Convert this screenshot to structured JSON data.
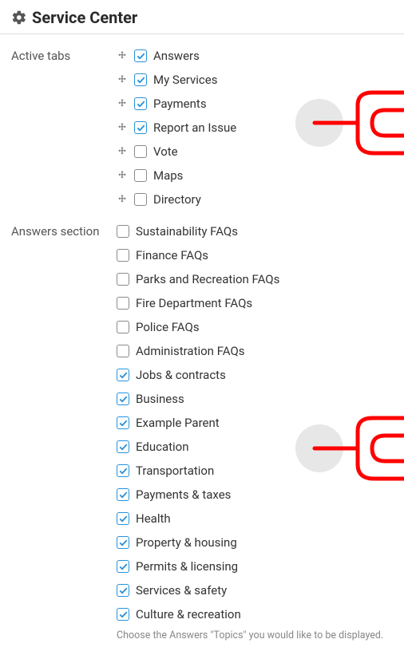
{
  "header": {
    "title": "Service Center"
  },
  "sections": {
    "active_tabs": {
      "label": "Active tabs",
      "items": [
        {
          "label": "Answers",
          "checked": true,
          "draggable": true
        },
        {
          "label": "My Services",
          "checked": true,
          "draggable": true
        },
        {
          "label": "Payments",
          "checked": true,
          "draggable": true
        },
        {
          "label": "Report an Issue",
          "checked": true,
          "draggable": true
        },
        {
          "label": "Vote",
          "checked": false,
          "draggable": true
        },
        {
          "label": "Maps",
          "checked": false,
          "draggable": true
        },
        {
          "label": "Directory",
          "checked": false,
          "draggable": true
        }
      ]
    },
    "answers_section": {
      "label": "Answers section",
      "helper": "Choose the Answers \"Topics\" you would like to be displayed.",
      "items": [
        {
          "label": "Sustainability FAQs",
          "checked": false
        },
        {
          "label": "Finance FAQs",
          "checked": false
        },
        {
          "label": "Parks and Recreation FAQs",
          "checked": false
        },
        {
          "label": "Fire Department FAQs",
          "checked": false
        },
        {
          "label": "Police FAQs",
          "checked": false
        },
        {
          "label": "Administration FAQs",
          "checked": false
        },
        {
          "label": "Jobs & contracts",
          "checked": true
        },
        {
          "label": "Business",
          "checked": true
        },
        {
          "label": "Example Parent",
          "checked": true
        },
        {
          "label": "Education",
          "checked": true
        },
        {
          "label": "Transportation",
          "checked": true
        },
        {
          "label": "Payments & taxes",
          "checked": true
        },
        {
          "label": "Health",
          "checked": true
        },
        {
          "label": "Property & housing",
          "checked": true
        },
        {
          "label": "Permits & licensing",
          "checked": true
        },
        {
          "label": "Services & safety",
          "checked": true
        },
        {
          "label": "Culture & recreation",
          "checked": true
        }
      ]
    }
  },
  "colors": {
    "accent": "#2793da",
    "annotation": "#ff0000"
  }
}
